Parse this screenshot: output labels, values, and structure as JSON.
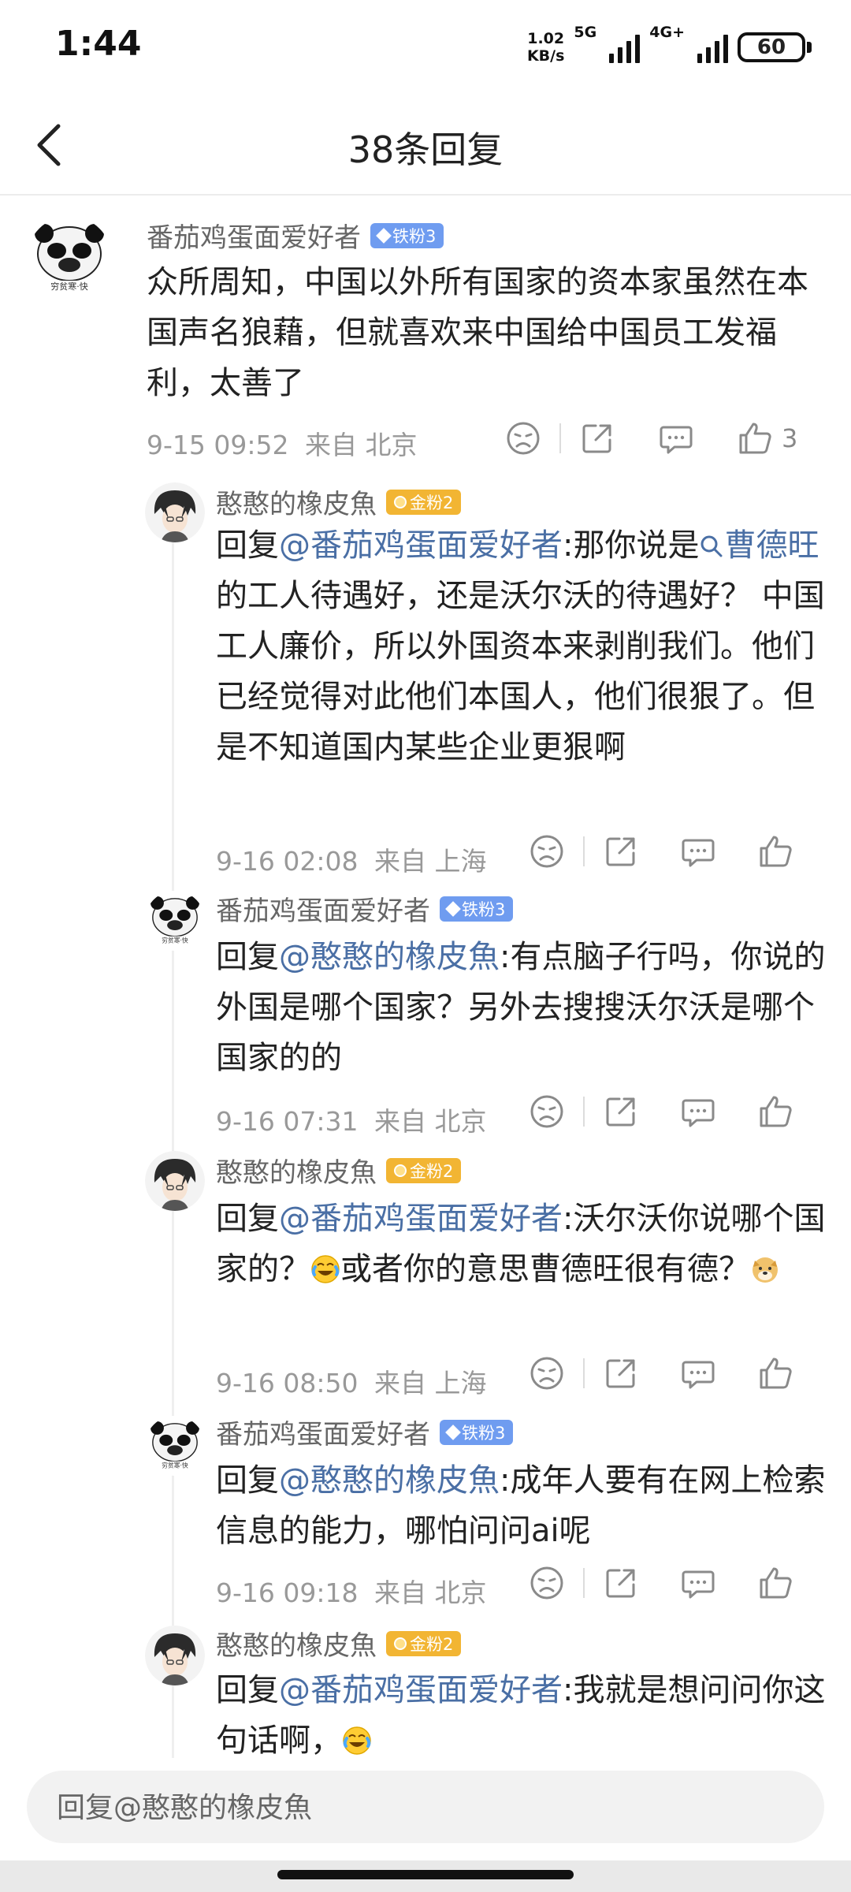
{
  "status_bar": {
    "time": "1:44",
    "net_speed_value": "1.02",
    "net_speed_unit": "KB/s",
    "sim1_label": "5G",
    "sim2_label": "4G+",
    "battery": "60"
  },
  "header": {
    "title": "38条回复"
  },
  "main_comment": {
    "username": "番茄鸡蛋面爱好者",
    "badge": "铁粉3",
    "text": "众所周知，中国以外所有国家的资本家虽然在本国声名狼藉，但就喜欢来中国给中国员工发福利，太善了",
    "time": "9-15 09:52",
    "location": "来自 北京",
    "likes": "3"
  },
  "replies": [
    {
      "username": "憨憨的橡皮魚",
      "badge": "金粉2",
      "reply_prefix": "回复",
      "mention": "@番茄鸡蛋面爱好者",
      "text_before_link": ":那你说是",
      "link": "曹德旺",
      "text_after_link": " 的工人待遇好，还是沃尔沃的待遇好？ 中国工人廉价，所以外国资本来剥削我们。他们已经觉得对此他们本国人，他们很狠了。但是不知道国内某些企业更狠啊",
      "time": "9-16 02:08",
      "location": "来自 上海"
    },
    {
      "username": "番茄鸡蛋面爱好者",
      "badge": "铁粉3",
      "reply_prefix": "回复",
      "mention": "@憨憨的橡皮魚",
      "text": ":有点脑子行吗，你说的外国是哪个国家？另外去搜搜沃尔沃是哪个国家的的",
      "time": "9-16 07:31",
      "location": "来自 北京"
    },
    {
      "username": "憨憨的橡皮魚",
      "badge": "金粉2",
      "reply_prefix": "回复",
      "mention": "@番茄鸡蛋面爱好者",
      "text_part1": ":沃尔沃你说哪个国家的？",
      "text_part2": "或者你的意思曹德旺很有德？",
      "time": "9-16 08:50",
      "location": "来自 上海"
    },
    {
      "username": "番茄鸡蛋面爱好者",
      "badge": "铁粉3",
      "reply_prefix": "回复",
      "mention": "@憨憨的橡皮魚",
      "text": ":成年人要有在网上检索信息的能力，哪怕问问ai呢",
      "time": "9-16 09:18",
      "location": "来自 北京"
    },
    {
      "username": "憨憨的橡皮魚",
      "badge": "金粉2",
      "reply_prefix": "回复",
      "mention": "@番茄鸡蛋面爱好者",
      "text": ":我就是想问问你这句话啊，"
    }
  ],
  "reply_bar": {
    "placeholder": "回复@憨憨的橡皮魚"
  },
  "colors": {
    "mention": "#4a6fa5",
    "iron_badge": "#6f9cf0",
    "gold_badge": "#f2b533"
  },
  "icons": [
    "back-icon",
    "dislike-icon",
    "share-icon",
    "comment-icon",
    "like-icon",
    "search-icon",
    "laugh-cry-emoji",
    "doge-emoji"
  ]
}
